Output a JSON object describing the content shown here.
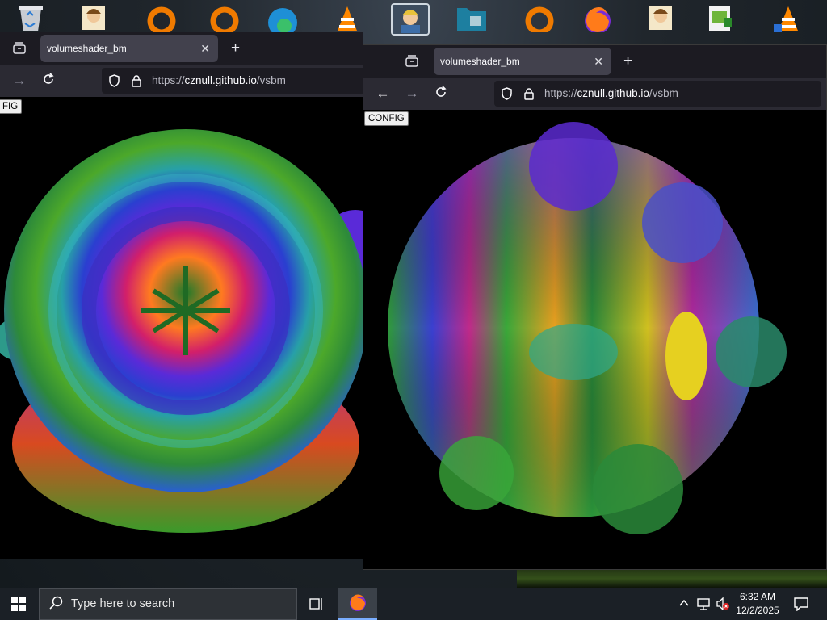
{
  "desktop": {
    "icons": [
      {
        "name": "recycle-bin-icon"
      },
      {
        "name": "user-app-icon"
      },
      {
        "name": "orange-ring-app-icon"
      },
      {
        "name": "orange-ring-app-icon-2"
      },
      {
        "name": "edge-icon"
      },
      {
        "name": "vlc-icon"
      },
      {
        "name": "user-folder-icon"
      },
      {
        "name": "python-folder-icon"
      },
      {
        "name": "orange-ring-app-icon-3"
      },
      {
        "name": "firefox-icon"
      },
      {
        "name": "user-app-icon-2"
      },
      {
        "name": "notepad-icon"
      },
      {
        "name": "vlc-icon-2"
      }
    ]
  },
  "left_window": {
    "tab_title": "volumeshader_bm",
    "tab_close": "✕",
    "new_tab": "+",
    "url_proto": "https://",
    "url_host": "cznull.github.io",
    "url_path": "/vsbm",
    "config_label": "FIG"
  },
  "right_window": {
    "tab_title": "volumeshader_bm",
    "tab_close": "✕",
    "new_tab": "+",
    "url_proto": "https://",
    "url_host": "cznull.github.io",
    "url_path": "/vsbm",
    "config_label": "CONFIG"
  },
  "taskbar": {
    "search_placeholder": "Type here to search",
    "time": "6:32 AM",
    "date": "12/2/2025"
  },
  "colors": {
    "browser_bg": "#1c1b22",
    "nav_bg": "#2b2a33",
    "tab_active": "#42414d",
    "taskbar_bg": "#1b2026"
  }
}
